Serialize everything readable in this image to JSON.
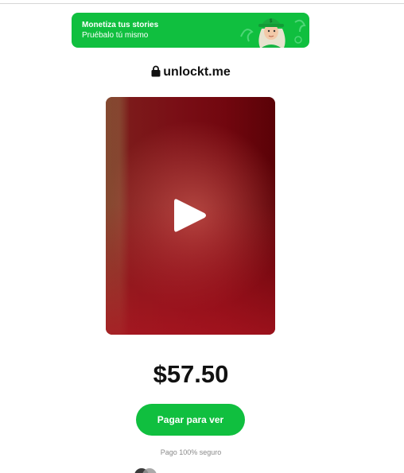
{
  "banner": {
    "title": "Monetiza tus stories",
    "subtitle": "Pruébalo tú mismo",
    "background_color": "#10bf3f"
  },
  "brand": {
    "lock_icon": "lock-icon",
    "name": "unlockt.me"
  },
  "media": {
    "play_icon": "play-icon"
  },
  "price": "$57.50",
  "pay_button": {
    "label": "Pagar para ver",
    "color": "#10bf3f"
  },
  "secure_note": "Pago 100% seguro",
  "payment_icons": [
    "card-circles-icon"
  ]
}
